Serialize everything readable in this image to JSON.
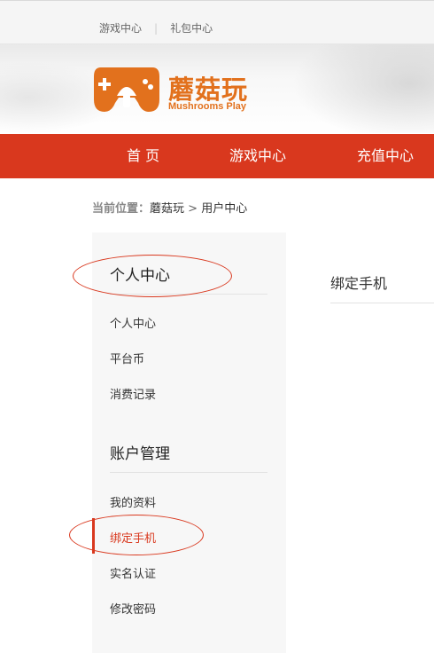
{
  "topbar": {
    "links": [
      "游戏中心",
      "礼包中心"
    ],
    "separator": "|"
  },
  "logo": {
    "name": "蘑菇玩",
    "subtitle": "Mushrooms Play"
  },
  "nav": {
    "items": [
      "首 页",
      "游戏中心",
      "充值中心"
    ]
  },
  "breadcrumb": {
    "label": "当前位置：",
    "home": "蘑菇玩",
    "sep": ">",
    "current": "用户中心"
  },
  "sidebar": {
    "section1": {
      "title": "个人中心",
      "items": [
        "个人中心",
        "平台币",
        "消费记录"
      ]
    },
    "section2": {
      "title": "账户管理",
      "items": [
        "我的资料",
        "绑定手机",
        "实名认证",
        "修改密码"
      ]
    },
    "active_item": "绑定手机"
  },
  "content": {
    "title": "绑定手机"
  },
  "colors": {
    "brand_red": "#d9381e",
    "logo_orange": "#e2711d"
  }
}
